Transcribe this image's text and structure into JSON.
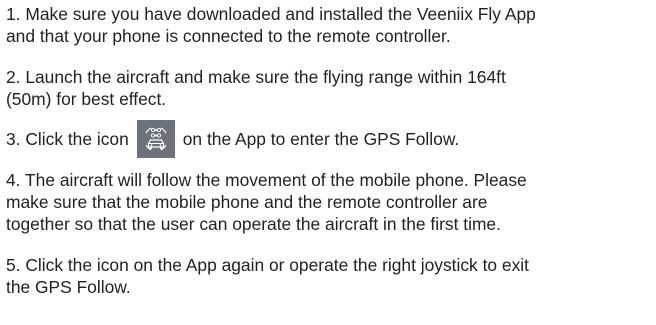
{
  "steps": [
    {
      "lines": [
        "1. Make sure you have downloaded and installed the Veeniix Fly App",
        "and that your phone is connected to the remote controller."
      ]
    },
    {
      "lines": [
        "2. Launch the aircraft and make sure the flying range within 164ft",
        "(50m) for best effect."
      ]
    },
    {
      "before_icon": "3. Click the icon",
      "after_icon": "on the App to enter the GPS Follow.",
      "icon": "gps-follow-icon"
    },
    {
      "lines": [
        "4. The aircraft will follow the movement of the mobile phone. Please",
        "make sure that the mobile phone and the remote controller are",
        "together so that the user can operate the aircraft in the first time."
      ]
    },
    {
      "lines": [
        "5. Click the icon on the App again or operate the right joystick to exit",
        "the GPS Follow."
      ]
    }
  ],
  "colors": {
    "text": "#222222",
    "icon_bg": "#6b7279",
    "icon_fg": "#ffffff"
  }
}
